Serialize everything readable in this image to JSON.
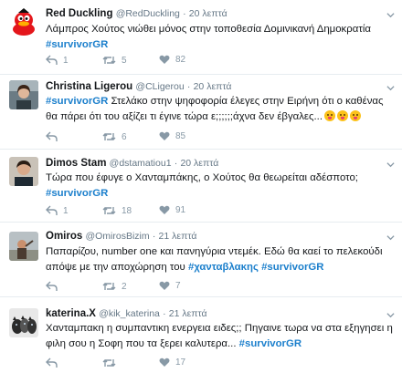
{
  "tweets": [
    {
      "name": "Red Duckling",
      "handle": "@RedDuckling",
      "dot": "·",
      "time": "20 λεπτά",
      "text_parts": [
        {
          "t": "Λάμπρος Χούτος νιώθει μόνος στην τοποθεσία Δομινικανή Δημοκρατία ",
          "tag": false
        },
        {
          "t": "#survivorGR",
          "tag": true
        }
      ],
      "reply_count": "1",
      "retweet_count": "5",
      "like_count": "82",
      "avatar": "red-duck-avatar"
    },
    {
      "name": "Christina Ligerou",
      "handle": "@CLigerou",
      "dot": "·",
      "time": "20 λεπτά",
      "text_parts": [
        {
          "t": "#survivorGR",
          "tag": true
        },
        {
          "t": " Στελάκο στην ψηφοφορία έλεγες στην Ειρήνη ότι ο καθένας θα πάρει ότι του αξίζει τι έγινε τώρα ε;;;;;;άχνα δεν έβγαλες...",
          "tag": false
        }
      ],
      "emoji_count": 3,
      "reply_count": "",
      "retweet_count": "6",
      "like_count": "85",
      "avatar": "photo-avatar"
    },
    {
      "name": "Dimos Stam",
      "handle": "@dstamatiou1",
      "dot": "·",
      "time": "20 λεπτά",
      "text_parts": [
        {
          "t": "Τώρα που έφυγε ο Χανταμπάκης, ο Χούτος θα θεωρείται αδέσποτο; ",
          "tag": false
        },
        {
          "t": "#survivorGR",
          "tag": true
        }
      ],
      "reply_count": "1",
      "retweet_count": "18",
      "like_count": "91",
      "avatar": "photo-avatar"
    },
    {
      "name": "Omiros",
      "handle": "@OmirosBizim",
      "dot": "·",
      "time": "21 λεπτά",
      "text_parts": [
        {
          "t": "Παπαρίζου, number one και πανηγύρια ντεμέκ. Εδώ θα καεί το πελεκούδι απόψε με την αποχώρηση του ",
          "tag": false
        },
        {
          "t": "#χανταβλακης",
          "tag": true
        },
        {
          "t": " ",
          "tag": false
        },
        {
          "t": "#survivorGR",
          "tag": true
        }
      ],
      "reply_count": "",
      "retweet_count": "2",
      "like_count": "7",
      "avatar": "photo-avatar"
    },
    {
      "name": "katerina.X",
      "handle": "@kik_katerina",
      "dot": "·",
      "time": "21 λεπτά",
      "text_parts": [
        {
          "t": "Χανταμπακη η συμπαντικη ενεργεια ειδες;; Πηγαινε τωρα να στα εξηγησει η φιλη σου η Σοφη που τα ξερει καλυτερα... ",
          "tag": false
        },
        {
          "t": "#survivorGR",
          "tag": true
        }
      ],
      "reply_count": "",
      "retweet_count": "",
      "like_count": "17",
      "avatar": "cats-avatar"
    }
  ],
  "colors": {
    "hashtag": "#1b7fcc",
    "muted": "#657786",
    "icon": "#8899a6",
    "divider": "#e6ecf0"
  }
}
